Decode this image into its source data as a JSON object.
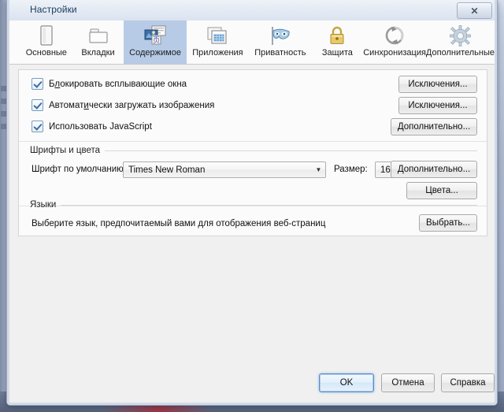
{
  "window": {
    "title": "Настройки",
    "close_label": "✕"
  },
  "tabs": [
    {
      "label": "Основные",
      "icon": "general-panel-icon",
      "selected": false
    },
    {
      "label": "Вкладки",
      "icon": "tabs-icon",
      "selected": false
    },
    {
      "label": "Содержимое",
      "icon": "content-icon",
      "selected": true
    },
    {
      "label": "Приложения",
      "icon": "applications-icon",
      "selected": false
    },
    {
      "label": "Приватность",
      "icon": "privacy-mask-icon",
      "selected": false
    },
    {
      "label": "Защита",
      "icon": "security-lock-icon",
      "selected": false
    },
    {
      "label": "Синхронизация",
      "icon": "sync-icon",
      "selected": false
    },
    {
      "label": "Дополнительные",
      "icon": "advanced-gear-icon",
      "selected": false
    }
  ],
  "content": {
    "checkboxes": [
      {
        "label_pre": "Б",
        "label_key": "л",
        "label_post": "окировать всплывающие окна",
        "checked": true
      },
      {
        "label_pre": "Автомат",
        "label_key": "и",
        "label_post": "чески загружать изображения",
        "checked": true
      },
      {
        "label_pre": "Использовать JavaScript",
        "label_key": "",
        "label_post": "",
        "checked": true
      }
    ],
    "checkbox_buttons": [
      {
        "label": "Исключения...",
        "name": "popup-exceptions-button"
      },
      {
        "label": "Исключения...",
        "name": "images-exceptions-button"
      },
      {
        "label": "Дополнительно...",
        "name": "javascript-advanced-button"
      }
    ],
    "fonts_group": {
      "header": "Шрифты и цвета",
      "font_label": "Шрифт по умолчанию:",
      "font_value": "Times New Roman",
      "size_label": "Размер:",
      "size_value": "16",
      "advanced_button": "Дополнительно...",
      "colors_button": "Цвета..."
    },
    "languages_group": {
      "header": "Языки",
      "description": "Выберите язык, предпочитаемый вами для отображения веб-страниц",
      "choose_button": "Выбрать..."
    }
  },
  "footer": {
    "ok": "OK",
    "cancel": "Отмена",
    "help": "Справка"
  },
  "colors": {
    "selected_tab": "#b7cbe6",
    "panel_bg": "#fbfbfb",
    "dialog_bg": "#f0f0f0",
    "title_text": "#1b3a5e"
  }
}
